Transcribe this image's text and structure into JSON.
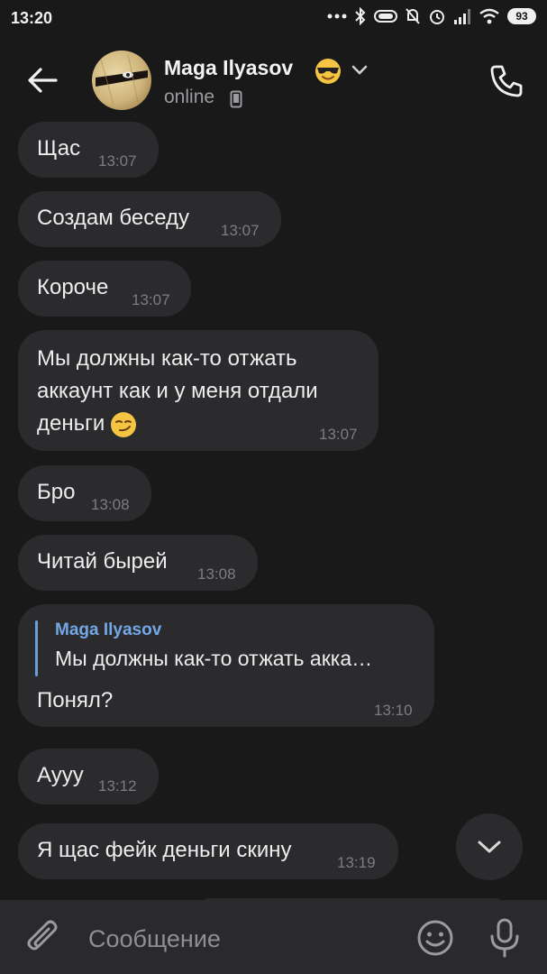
{
  "status_bar": {
    "time": "13:20",
    "battery": "93",
    "icons": [
      "more-dots-icon",
      "bluetooth-icon",
      "pill-icon",
      "mute-bell-icon",
      "alarm-icon",
      "signal-icon",
      "wifi-icon",
      "battery-icon"
    ]
  },
  "header": {
    "contact_name": "Maga Ilyasov",
    "name_emoji": "smiling-face-with-sunglasses-icon",
    "status": "online",
    "status_icon": "mobile-phone-icon",
    "icons": [
      "back-arrow-icon",
      "chevron-down-icon",
      "phone-call-icon"
    ]
  },
  "messages": [
    {
      "text": "Щас",
      "time": "13:07"
    },
    {
      "text": "Создам беседу",
      "time": "13:07"
    },
    {
      "text": "Короче",
      "time": "13:07"
    },
    {
      "lines": [
        "Мы должны как-то отжать",
        "аккаунт как и у меня отдали",
        "деньги"
      ],
      "emoji": "smirking-face-icon",
      "time": "13:07"
    },
    {
      "text": "Бро",
      "time": "13:08"
    },
    {
      "text": "Читай бырей",
      "time": "13:08"
    },
    {
      "reply_author": "Maga Ilyasov",
      "reply_text": "Мы должны как-то отжать акка…",
      "text": "Понял?",
      "time": "13:10"
    },
    {
      "text": "Ауyy",
      "time": "13:12"
    },
    {
      "text": "Я щас фейк деньги скину",
      "time": "13:19"
    }
  ],
  "composer": {
    "placeholder": "Сообщение",
    "icons": [
      "paperclip-icon",
      "emoji-smile-icon",
      "microphone-icon"
    ]
  },
  "colors": {
    "background": "#19191a",
    "bubble": "#2b2b2e",
    "accent": "#73a7e6",
    "time": "#7c7c82"
  }
}
